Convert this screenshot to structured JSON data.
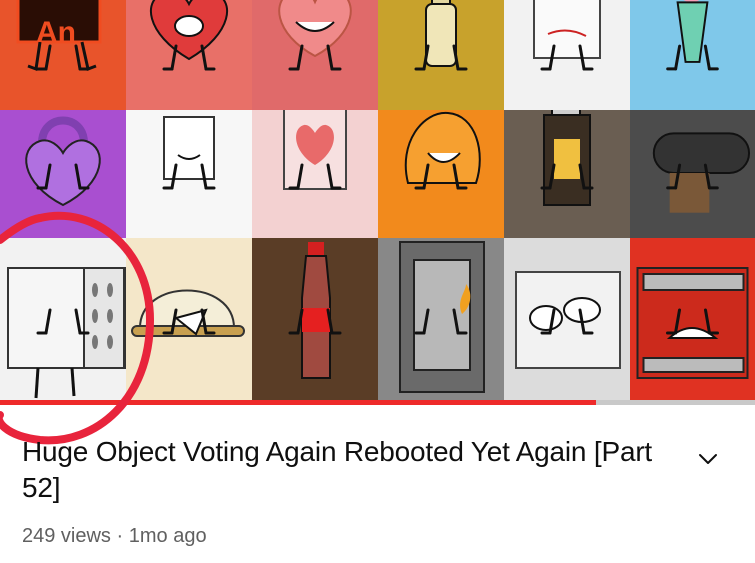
{
  "video": {
    "title": "Huge Object Voting Again Rebooted Yet Again [Part 52]",
    "views": "249 views",
    "separator": "·",
    "age": "1mo ago",
    "watched_fraction": 0.79
  },
  "thumbnail_tiles": [
    {
      "name": "tile-animate-logo",
      "bg": "#e8542b",
      "label": "An"
    },
    {
      "name": "tile-heart",
      "bg": "#e87068"
    },
    {
      "name": "tile-gift-heart",
      "bg": "#e06a6a"
    },
    {
      "name": "tile-bottle",
      "bg": "#c8a22c"
    },
    {
      "name": "tile-paper",
      "bg": "#f2f2f2"
    },
    {
      "name": "tile-flower-pot",
      "bg": "#7fc8ea"
    },
    {
      "name": "tile-padlock",
      "bg": "#a94fd0"
    },
    {
      "name": "tile-blank-card",
      "bg": "#f7f7f7"
    },
    {
      "name": "tile-card-heart",
      "bg": "#f3d1d1"
    },
    {
      "name": "tile-beanbag",
      "bg": "#f28a1c"
    },
    {
      "name": "tile-lighter",
      "bg": "#6a5e52"
    },
    {
      "name": "tile-cannon",
      "bg": "#4c4c4c"
    },
    {
      "name": "tile-dice-box",
      "bg": "#f2f2f2"
    },
    {
      "name": "tile-dome",
      "bg": "#f4e7c9"
    },
    {
      "name": "tile-soda-bottle",
      "bg": "#5a3d26"
    },
    {
      "name": "tile-lantern",
      "bg": "#888888"
    },
    {
      "name": "tile-cube",
      "bg": "#dcdcdc"
    },
    {
      "name": "tile-cage",
      "bg": "#e03222"
    }
  ],
  "colors": {
    "progress": "#ee2a2a",
    "annotation": "#e8243c",
    "meta_text": "#606060",
    "title_text": "#0f0f0f"
  },
  "icons": {
    "expand": "chevron-down-icon"
  }
}
